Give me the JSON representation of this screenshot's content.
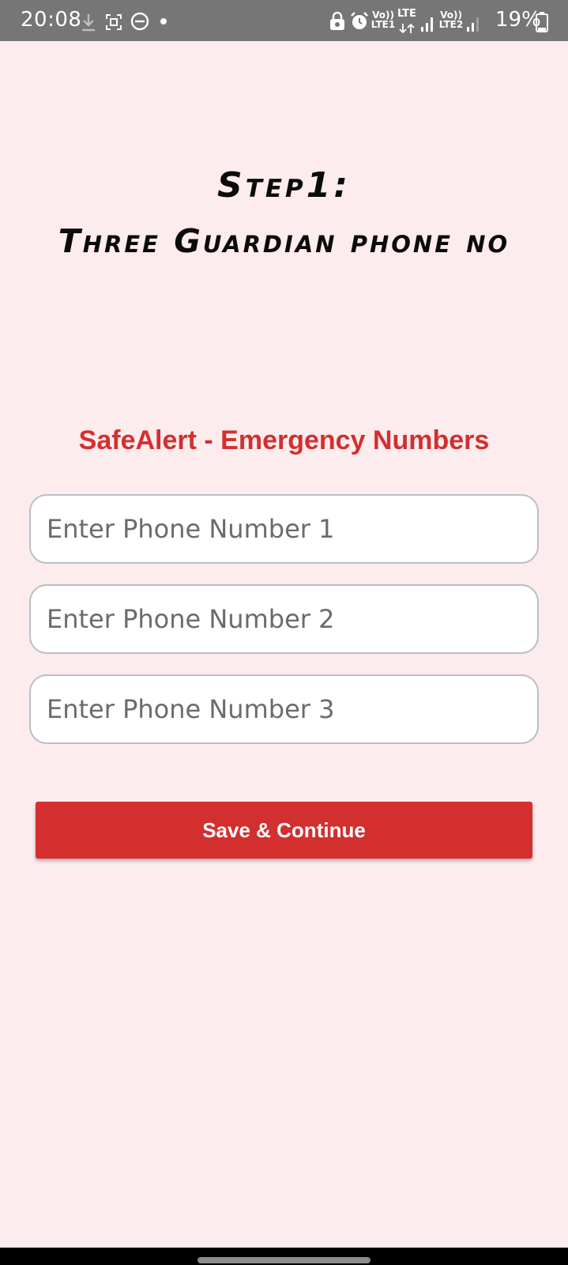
{
  "status_bar": {
    "time": "20:08",
    "battery": "19%",
    "sim1_label": "Vo)) LTE1",
    "lte_label": "LTE",
    "sim2_label": "Vo)) LTE2",
    "icons": [
      "download-icon",
      "screenshot-icon",
      "dnd-icon",
      "dot-icon",
      "lock-icon",
      "alarm-icon",
      "signal-icon",
      "battery-icon"
    ],
    "color": "#767676"
  },
  "step": {
    "line1": "Step1:",
    "line2": "Three Guardian phone no"
  },
  "app": {
    "heading": "SafeAlert - Emergency Numbers",
    "accent_color": "#d32f2f",
    "background_color": "#fdeced"
  },
  "form": {
    "phone1": {
      "placeholder": "Enter Phone Number 1",
      "value": ""
    },
    "phone2": {
      "placeholder": "Enter Phone Number 2",
      "value": ""
    },
    "phone3": {
      "placeholder": "Enter Phone Number 3",
      "value": ""
    },
    "submit_label": "Save & Continue"
  }
}
